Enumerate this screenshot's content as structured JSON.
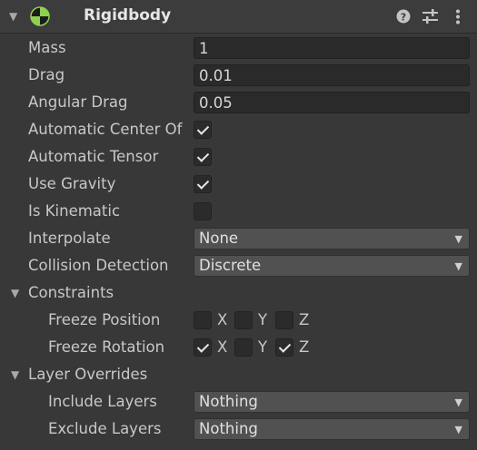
{
  "component": {
    "title": "Rigidbody",
    "expand_icon": "triangle-down-icon",
    "header_icons": [
      "help-icon",
      "preset-sliders-icon",
      "more-vertical-icon"
    ]
  },
  "fields": {
    "mass": {
      "label": "Mass",
      "value": "1"
    },
    "drag": {
      "label": "Drag",
      "value": "0.01"
    },
    "angular_drag": {
      "label": "Angular Drag",
      "value": "0.05"
    },
    "auto_center": {
      "label": "Automatic Center Of",
      "checked": true
    },
    "auto_tensor": {
      "label": "Automatic Tensor",
      "checked": true
    },
    "use_gravity": {
      "label": "Use Gravity",
      "checked": true
    },
    "is_kinematic": {
      "label": "Is Kinematic",
      "checked": false
    },
    "interpolate": {
      "label": "Interpolate",
      "value": "None"
    },
    "collision": {
      "label": "Collision Detection",
      "value": "Discrete"
    }
  },
  "constraints": {
    "label": "Constraints",
    "freeze_position": {
      "label": "Freeze Position",
      "x": false,
      "y": false,
      "z": false
    },
    "freeze_rotation": {
      "label": "Freeze Rotation",
      "x": true,
      "y": false,
      "z": true
    },
    "axes": {
      "x": "X",
      "y": "Y",
      "z": "Z"
    }
  },
  "layer_overrides": {
    "label": "Layer Overrides",
    "include": {
      "label": "Include Layers",
      "value": "Nothing"
    },
    "exclude": {
      "label": "Exclude Layers",
      "value": "Nothing"
    }
  },
  "colors": {
    "background": "#383838",
    "field": "#2a2a2a",
    "dropdown": "#515151",
    "icon_green": "#8fd14f"
  }
}
